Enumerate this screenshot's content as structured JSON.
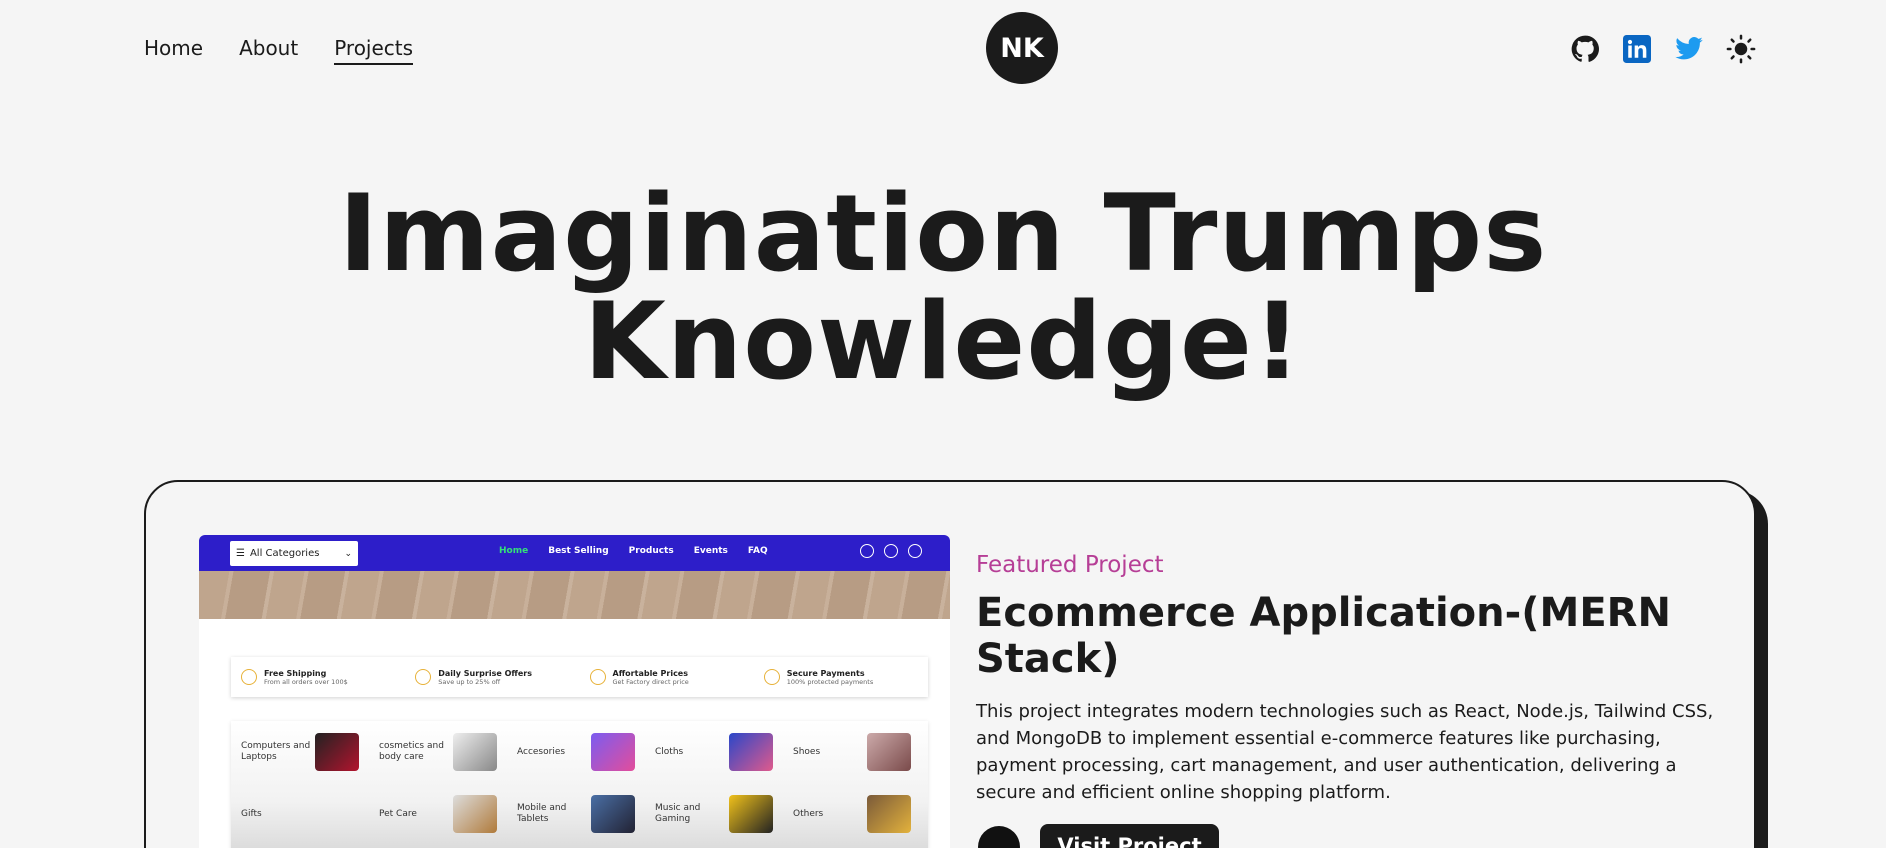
{
  "nav": {
    "links": [
      {
        "label": "Home",
        "active": false
      },
      {
        "label": "About",
        "active": false
      },
      {
        "label": "Projects",
        "active": true
      }
    ],
    "logo": "NK",
    "socials": [
      {
        "icon": "github-icon"
      },
      {
        "icon": "linkedin-icon"
      },
      {
        "icon": "twitter-icon"
      },
      {
        "icon": "sun-icon"
      }
    ]
  },
  "hero": {
    "line1": "Imagination Trumps",
    "line2": "Knowledge!"
  },
  "project": {
    "eyebrow": "Featured Project",
    "title": "Ecommerce Application-(MERN Stack)",
    "description": "This project integrates modern technologies such as React, Node.js, Tailwind CSS, and MongoDB to implement essential e-commerce features like purchasing, payment processing, cart management, and user authentication, delivering a secure and efficient online shopping platform.",
    "visit_label": "Visit Project",
    "screenshot": {
      "category_button": "All Categories",
      "menu": [
        "Home",
        "Best Selling",
        "Products",
        "Events",
        "FAQ"
      ],
      "features": [
        {
          "title": "Free Shipping",
          "sub": "From all orders over 100$"
        },
        {
          "title": "Daily Surprise Offers",
          "sub": "Save up to 25% off"
        },
        {
          "title": "Affortable Prices",
          "sub": "Get Factory direct price"
        },
        {
          "title": "Secure Payments",
          "sub": "100% protected payments"
        }
      ],
      "categories": [
        "Computers and Laptops",
        "cosmetics and body care",
        "Accesories",
        "Cloths",
        "Shoes",
        "Gifts",
        "Pet Care",
        "Mobile and Tablets",
        "Music and Gaming",
        "Others"
      ]
    }
  },
  "colors": {
    "accent": "#b63e96",
    "dark": "#1b1b1b",
    "background": "#f5f5f5",
    "screenshot_header": "#2d1ec9",
    "linkedin": "#0a66c2",
    "twitter": "#1d9bf0"
  }
}
